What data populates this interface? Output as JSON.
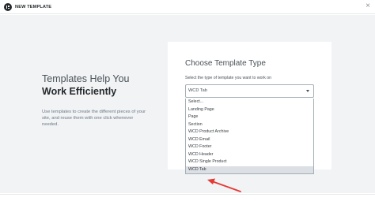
{
  "header": {
    "title": "NEW TEMPLATE",
    "close_icon": "close-icon"
  },
  "intro": {
    "heading_line1": "Templates Help You",
    "heading_line2": "Work Efficiently",
    "description": "Use templates to create the different pieces of your site, and reuse them with one click whenever needed."
  },
  "form": {
    "title": "Choose Template Type",
    "label": "Select the type of template you want to work on",
    "select_value": "WCD Tab",
    "options": [
      "Select...",
      "Landing Page",
      "Page",
      "Section",
      "WCD Product Archive",
      "WCD Email",
      "WCD Footer",
      "WCD Header",
      "WCD Single Product",
      "WCD Tab"
    ],
    "selected_option": "WCD Tab"
  },
  "colors": {
    "annotation_arrow": "#e53935",
    "panel_bg": "#ffffff",
    "page_bg": "#f1f3f5",
    "option_highlight": "#dcdfe3"
  }
}
